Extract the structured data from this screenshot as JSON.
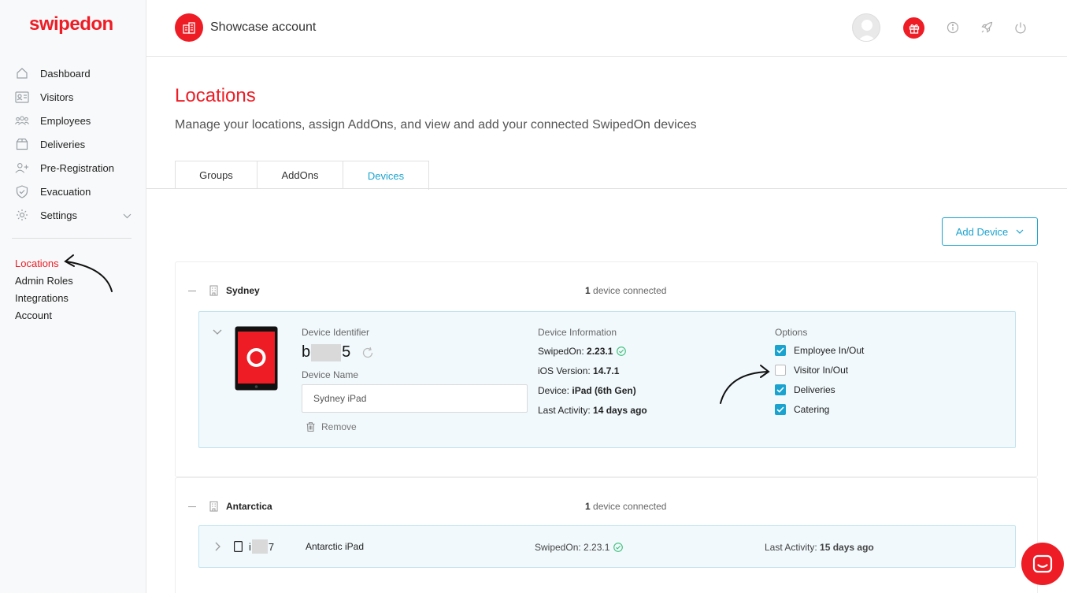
{
  "brand": {
    "logo_text": "swipedon",
    "accent": "#ee1c25",
    "link": "#1aa3cf"
  },
  "sidebar": {
    "items": [
      {
        "label": "Dashboard",
        "icon": "home-icon"
      },
      {
        "label": "Visitors",
        "icon": "visitor-card-icon"
      },
      {
        "label": "Employees",
        "icon": "employees-icon"
      },
      {
        "label": "Deliveries",
        "icon": "box-icon"
      },
      {
        "label": "Pre-Registration",
        "icon": "add-user-icon"
      },
      {
        "label": "Evacuation",
        "icon": "shield-icon"
      },
      {
        "label": "Settings",
        "icon": "gear-icon"
      }
    ],
    "settings_sub": [
      "Locations",
      "Admin Roles",
      "Integrations",
      "Account"
    ]
  },
  "topbar": {
    "account_name": "Showcase account"
  },
  "page": {
    "title": "Locations",
    "subtitle": "Manage your locations, assign AddOns, and view and add your connected SwipedOn devices",
    "tabs": [
      "Groups",
      "AddOns",
      "Devices"
    ],
    "active_tab": "Devices",
    "add_device_label": "Add Device"
  },
  "locations": [
    {
      "name": "Sydney",
      "count_num": "1",
      "count_text": "device connected",
      "device": {
        "identifier_label": "Device Identifier",
        "id_start": "b",
        "id_end": "5",
        "name_label": "Device Name",
        "name_value": "Sydney iPad",
        "remove_label": "Remove",
        "info_label": "Device Information",
        "swipedon_key": "SwipedOn:",
        "swipedon_val": "2.23.1",
        "ios_key": "iOS Version:",
        "ios_val": "14.7.1",
        "device_key": "Device:",
        "device_val": "iPad (6th Gen)",
        "activity_key": "Last Activity:",
        "activity_val": "14 days ago",
        "options_label": "Options",
        "options": [
          {
            "label": "Employee In/Out",
            "checked": true
          },
          {
            "label": "Visitor In/Out",
            "checked": false
          },
          {
            "label": "Deliveries",
            "checked": true
          },
          {
            "label": "Catering",
            "checked": true
          }
        ]
      }
    },
    {
      "name": "Antarctica",
      "count_num": "1",
      "count_text": "device connected",
      "device": {
        "id_start": "i",
        "id_end": "7",
        "name_value": "Antarctic iPad",
        "swipedon_key": "SwipedOn:",
        "swipedon_val": "2.23.1",
        "activity_key": "Last Activity:",
        "activity_val": "15 days ago"
      }
    }
  ]
}
